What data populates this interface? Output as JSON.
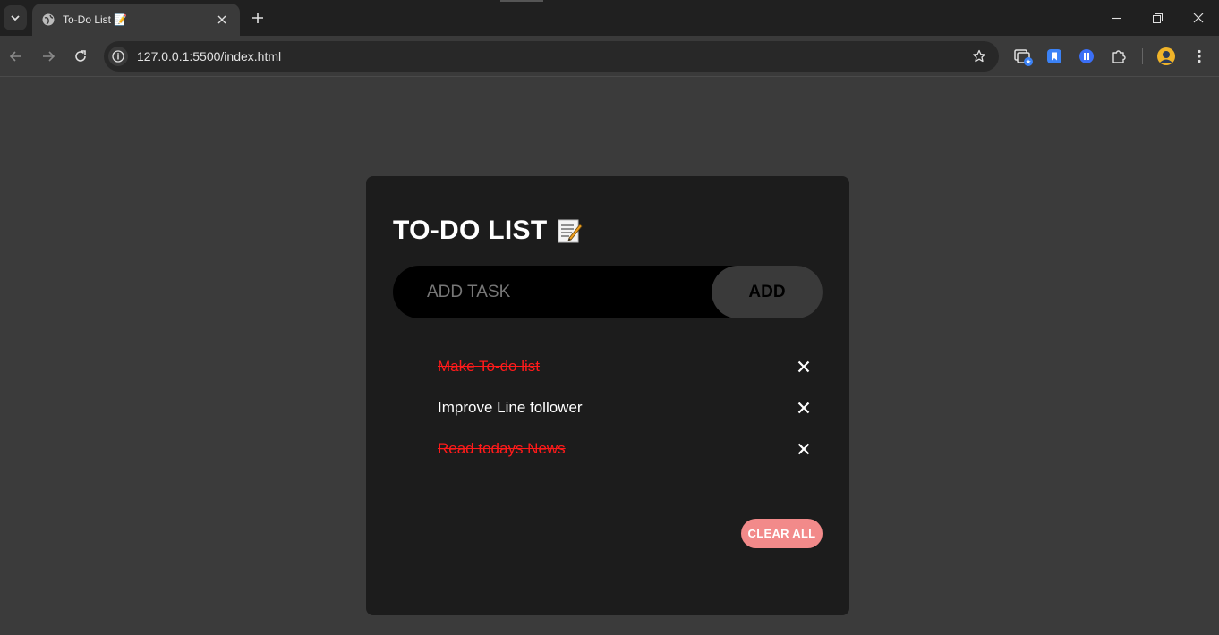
{
  "browser": {
    "tab": {
      "title": "To-Do List 📝"
    },
    "address": {
      "url": "127.0.0.1:5500/index.html"
    }
  },
  "app": {
    "heading": "TO-DO LIST",
    "input": {
      "placeholder": "ADD TASK",
      "value": ""
    },
    "add_label": "ADD",
    "tasks": [
      {
        "text": "Make To-do list",
        "done": true
      },
      {
        "text": "Improve Line follower",
        "done": false
      },
      {
        "text": "Read todays News",
        "done": true
      }
    ],
    "clear_label": "CLEAR ALL"
  },
  "colors": {
    "page_bg": "#3b3b3b",
    "card_bg": "#1c1c1c",
    "done_text": "#ff1a1a",
    "clear_button": "#f28a8a"
  }
}
